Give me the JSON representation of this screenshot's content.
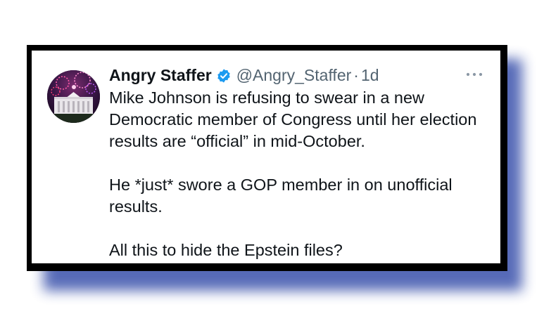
{
  "tweet": {
    "author_name": "Angry Staffer",
    "verified_icon": "verified-badge-icon",
    "handle": "@Angry_Staffer",
    "separator": "·",
    "time": "1d",
    "more_icon": "more-options-icon",
    "paragraphs": [
      "Mike Johnson is refusing to swear in a new Democratic member of Congress until her election results are “official” in mid-October.",
      "He *just* swore a GOP member in on unofficial results.",
      "All this to hide the Epstein files?"
    ]
  },
  "colors": {
    "frame": "#000000",
    "shadow": "#4e63b4",
    "verified": "#1d9bf0",
    "text": "#0f1419",
    "secondary_text": "#536471"
  }
}
